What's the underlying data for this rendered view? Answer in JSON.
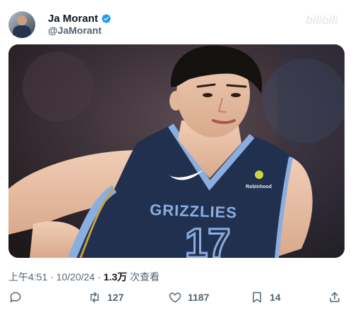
{
  "author": {
    "display_name": "Ja Morant",
    "handle": "@JaMorant",
    "verified": true
  },
  "watermark": "bilibili",
  "photo": {
    "jersey_team": "GRIZZLIES",
    "jersey_number": "17",
    "sponsor": "Robinhood"
  },
  "meta": {
    "time": "上午4:51",
    "date": "10/20/24",
    "views_count": "1.3万",
    "views_label": "次查看",
    "sep": " · "
  },
  "actions": {
    "reply_icon": "reply-icon",
    "retweet_count": "127",
    "like_count": "1187",
    "bookmark_count": "14",
    "share_icon": "share-icon"
  },
  "colors": {
    "verified": "#1d9bf0",
    "secondary_text": "#536471",
    "jersey_navy": "#22304f",
    "jersey_blue": "#8aaee0"
  }
}
